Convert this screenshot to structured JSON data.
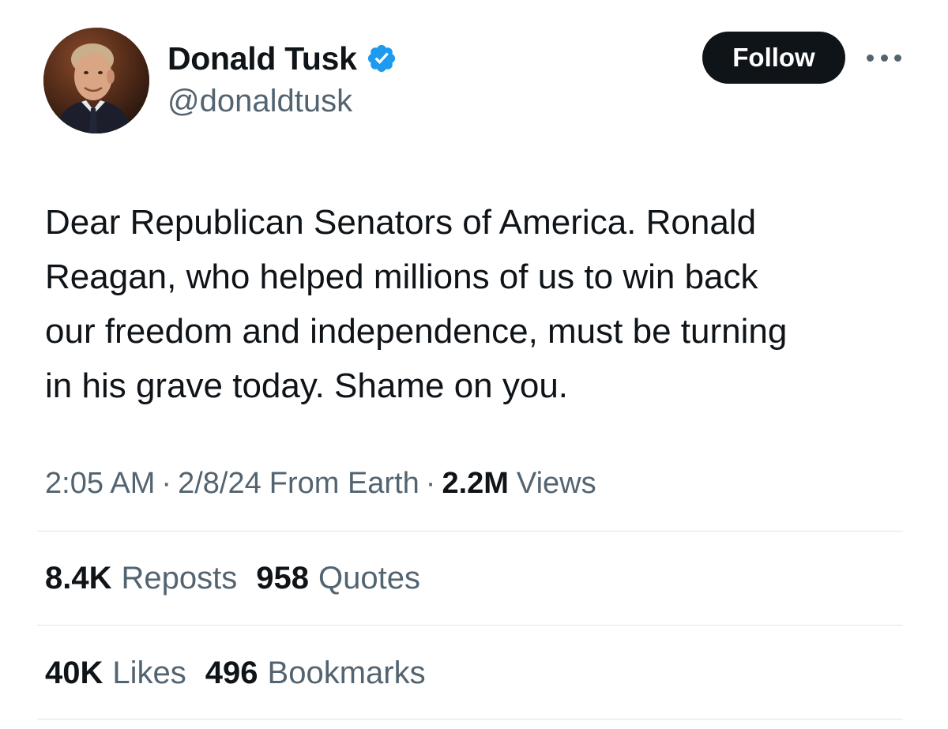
{
  "author": {
    "display_name": "Donald Tusk",
    "handle": "@donaldtusk",
    "verified": true,
    "verified_badge_color": "#1d9bf0",
    "avatar_icon": "profile-photo"
  },
  "actions": {
    "follow_label": "Follow",
    "more_icon": "more-horizontal-icon"
  },
  "tweet": {
    "text": "Dear Republican Senators of America. Ronald\nReagan, who helped millions of us to win back\nour freedom and independence, must be turning\nin his grave today. Shame on you."
  },
  "meta": {
    "time": "2:05 AM",
    "date": "2/8/24",
    "location": "From Earth",
    "separator": "·",
    "views_count": "2.2M",
    "views_label": "Views"
  },
  "stats": {
    "reposts_count": "8.4K",
    "reposts_label": "Reposts",
    "quotes_count": "958",
    "quotes_label": "Quotes",
    "likes_count": "40K",
    "likes_label": "Likes",
    "bookmarks_count": "496",
    "bookmarks_label": "Bookmarks"
  },
  "colors": {
    "text_primary": "#0f1419",
    "text_secondary": "#536471",
    "button_bg": "#0f1419",
    "divider": "#dfe4e8"
  }
}
